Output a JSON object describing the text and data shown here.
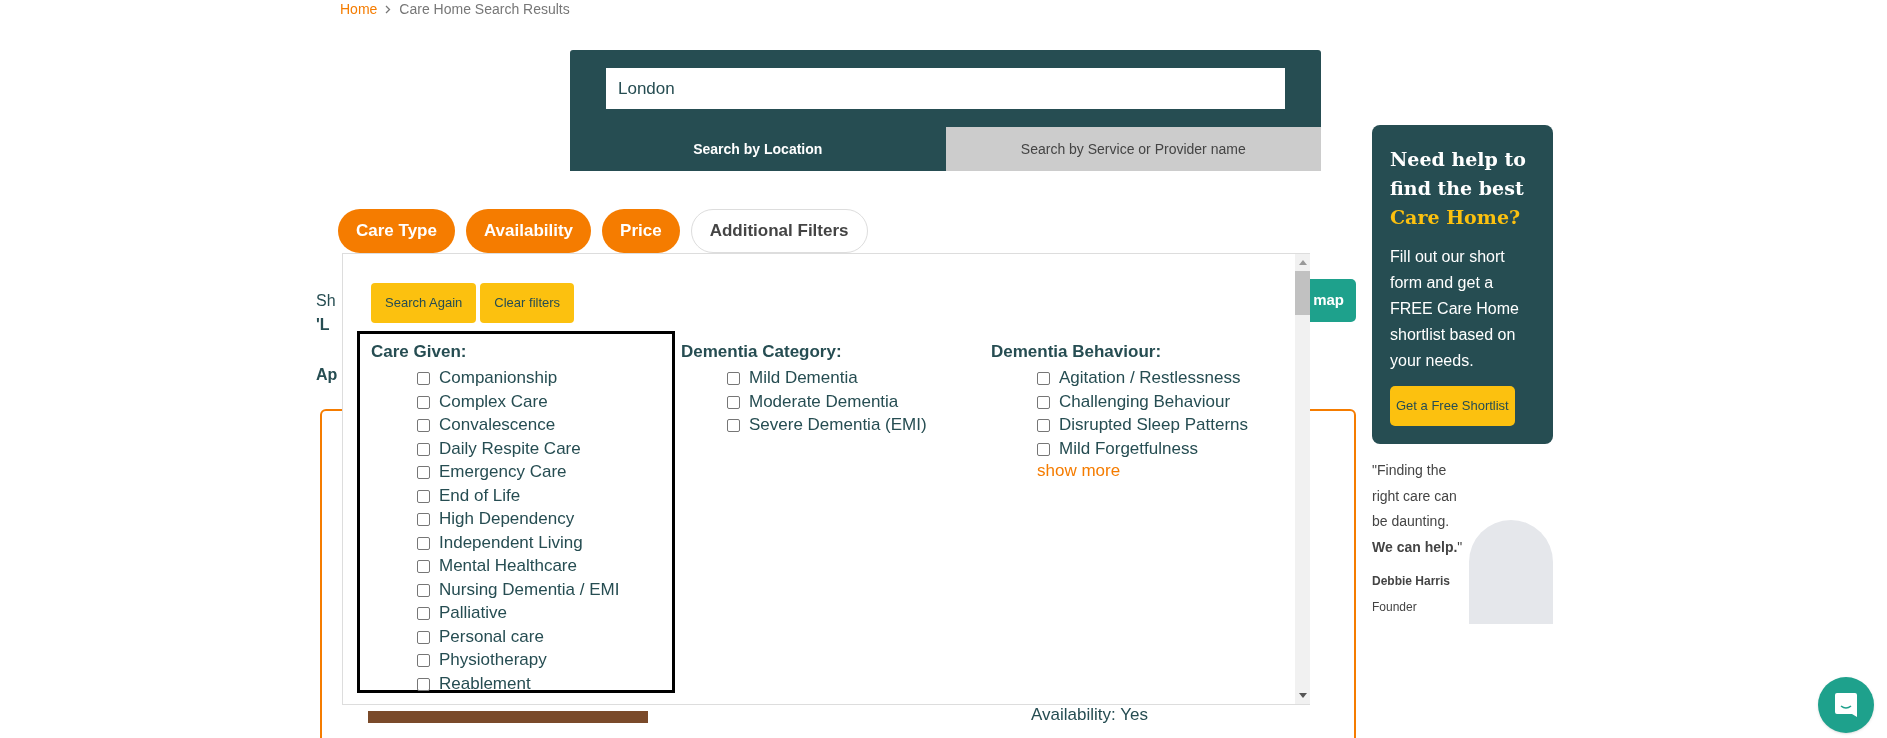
{
  "breadcrumb": [
    {
      "label": "Home",
      "kind": "link"
    },
    {
      "label": "Care Home Search Results",
      "kind": "current"
    }
  ],
  "search": {
    "value": "London",
    "tabs": [
      {
        "label": "Search by Location",
        "selected": true
      },
      {
        "label": "Search by Service or Provider name",
        "selected": false
      }
    ]
  },
  "filter_tabs": [
    {
      "label": "Care Type",
      "active": true
    },
    {
      "label": "Availability",
      "active": true
    },
    {
      "label": "Price",
      "active": true
    },
    {
      "label": "Additional Filters",
      "active": false
    }
  ],
  "results": {
    "line_1": "Sh",
    "line_2": "'L",
    "line_3": "Ap",
    "map_button": "map",
    "card_text": "Availability: Yes"
  },
  "filter_panel": {
    "buttons": [
      "Search Again",
      "Clear filters"
    ],
    "groups": [
      {
        "title": "Care Given:",
        "highlighted": true,
        "options": [
          {
            "label": "Companionship",
            "checked": false
          },
          {
            "label": "Complex Care",
            "checked": false
          },
          {
            "label": "Convalescence",
            "checked": false
          },
          {
            "label": "Daily Respite Care",
            "checked": false
          },
          {
            "label": "Emergency Care",
            "checked": false
          },
          {
            "label": "End of Life",
            "checked": false
          },
          {
            "label": "High Dependency",
            "checked": false
          },
          {
            "label": "Independent Living",
            "checked": false
          },
          {
            "label": "Mental Healthcare",
            "checked": false
          },
          {
            "label": "Nursing Dementia / EMI",
            "checked": false
          },
          {
            "label": "Palliative",
            "checked": false
          },
          {
            "label": "Personal care",
            "checked": false
          },
          {
            "label": "Physiotherapy",
            "checked": false
          },
          {
            "label": "Reablement",
            "checked": false
          }
        ]
      },
      {
        "title": "Dementia Category:",
        "highlighted": false,
        "options": [
          {
            "label": "Mild Dementia",
            "checked": false
          },
          {
            "label": "Moderate Dementia",
            "checked": false
          },
          {
            "label": "Severe Dementia (EMI)",
            "checked": false
          }
        ]
      },
      {
        "title": "Dementia Behaviour:",
        "highlighted": false,
        "options": [
          {
            "label": "Agitation / Restlessness",
            "checked": false
          },
          {
            "label": "Challenging Behaviour",
            "checked": false
          },
          {
            "label": "Disrupted Sleep Patterns",
            "checked": false
          },
          {
            "label": "Mild Forgetfulness",
            "checked": false
          }
        ],
        "show_more": "show more"
      }
    ]
  },
  "sidebar": {
    "heading": "Need help to find the best",
    "heading_highlight": "Care Home?",
    "text": "Fill out our short form and get a FREE Care Home shortlist based on your needs.",
    "button": "Get a Free Shortlist"
  },
  "quote": {
    "text": "\"Finding the right care can be daunting. **We can help.**\"",
    "name": "Debbie Harris",
    "role": "Founder"
  }
}
